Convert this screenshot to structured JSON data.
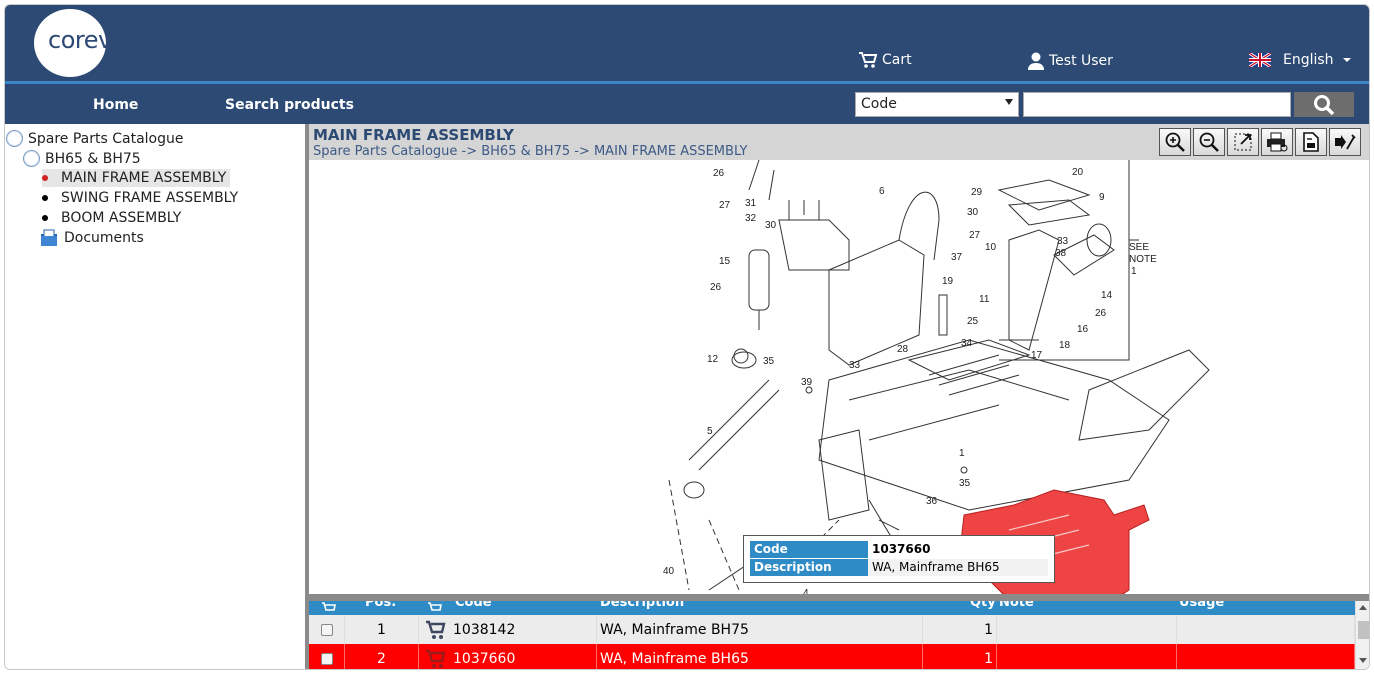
{
  "brand": {
    "name": "corevist"
  },
  "header": {
    "cart_label": "Cart",
    "user_label": "Test User",
    "language_label": "English"
  },
  "nav": {
    "home": "Home",
    "search_products": "Search products"
  },
  "search": {
    "field_selected": "Code",
    "query_value": ""
  },
  "tree": {
    "root": "Spare Parts Catalogue",
    "model": "BH65 & BH75",
    "items": [
      {
        "label": "MAIN FRAME ASSEMBLY",
        "selected": true
      },
      {
        "label": "SWING FRAME ASSEMBLY",
        "selected": false
      },
      {
        "label": "BOOM ASSEMBLY",
        "selected": false
      }
    ],
    "documents": "Documents"
  },
  "content": {
    "title": "MAIN FRAME ASSEMBLY",
    "breadcrumb": "Spare Parts Catalogue -> BH65 & BH75 -> MAIN FRAME ASSEMBLY",
    "tools": [
      "zoom-in-icon",
      "zoom-out-icon",
      "fit-screen-icon",
      "print-icon",
      "export-icon",
      "settings-icon"
    ]
  },
  "drawing": {
    "labels": [
      "26",
      "20",
      "9",
      "31",
      "27",
      "6",
      "29",
      "30",
      "32",
      "27",
      "30",
      "33",
      "38",
      "10",
      "SEE",
      "NOTE",
      "1",
      "15",
      "37",
      "14",
      "19",
      "26",
      "26",
      "25",
      "11",
      "16",
      "34",
      "28",
      "33",
      "18",
      "17",
      "12",
      "35",
      "39",
      "1",
      "5",
      "35",
      "36",
      "40",
      "4"
    ]
  },
  "tooltip": {
    "code_label": "Code",
    "code_value": "1037660",
    "desc_label": "Description",
    "desc_value": "WA, Mainframe BH65"
  },
  "grid": {
    "headers": [
      "Pos.",
      "Code",
      "Description",
      "Qty",
      "Note",
      "Usage"
    ],
    "rows": [
      {
        "pos": "1",
        "code": "1038142",
        "description": "WA, Mainframe BH75",
        "qty": "1",
        "highlighted": false
      },
      {
        "pos": "2",
        "code": "1037660",
        "description": "WA, Mainframe BH65",
        "qty": "1",
        "highlighted": true
      }
    ]
  },
  "colors": {
    "header": "#2c4a73",
    "accent": "#3a86c8",
    "grid_header": "#2f8bc5",
    "highlight": "#ff0000",
    "hotspot": "#ee4444"
  }
}
